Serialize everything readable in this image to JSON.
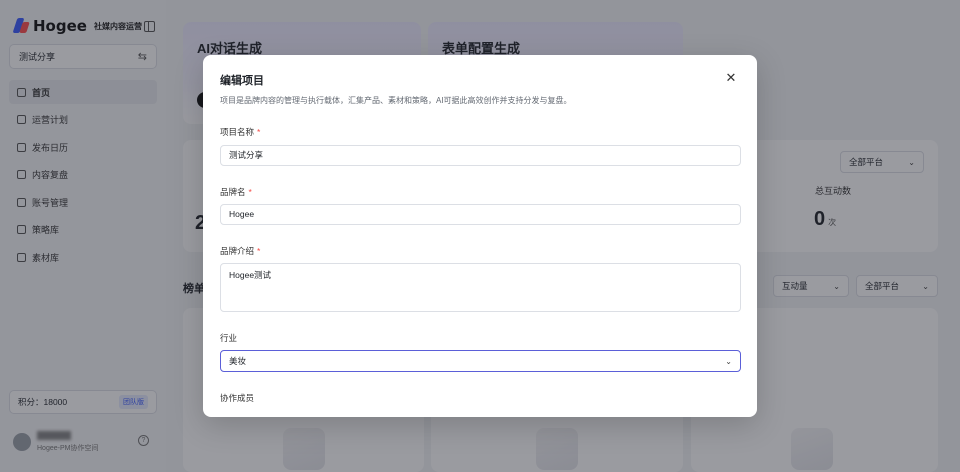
{
  "app": {
    "logo_text": "Hogee",
    "logo_sub": "社媒内容运营",
    "project_switch": "测试分享",
    "nav": [
      {
        "label": "首页",
        "active": true
      },
      {
        "label": "运营计划"
      },
      {
        "label": "发布日历"
      },
      {
        "label": "内容复盘"
      },
      {
        "label": "账号管理"
      },
      {
        "label": "策略库"
      },
      {
        "label": "素材库"
      }
    ],
    "points_label": "积分：18000",
    "team_badge": "团队版",
    "user_space": "Hogee-PM协作空间"
  },
  "main": {
    "card_ai_title": "AI对话生成",
    "card_form_title": "表单配置生成",
    "stats_platform": "全部平台",
    "stats_total_label": "总互动数",
    "stats_total_value": "0",
    "stats_total_unit": "次",
    "stats_left_value": "2",
    "ranking_title": "榜单",
    "ranking_metric": "互动量",
    "ranking_platform": "全部平台"
  },
  "modal": {
    "title": "编辑项目",
    "description": "项目是品牌内容的管理与执行载体，汇集产品、素材和策略，AI可据此高效创作并支持分发与复盘。",
    "fields": {
      "project_name_label": "项目名称",
      "project_name_value": "测试分享",
      "brand_label": "品牌名",
      "brand_value": "Hogee",
      "brand_intro_label": "品牌介绍",
      "brand_intro_value": "Hogee测试",
      "industry_label": "行业",
      "industry_value": "美妆",
      "members_label": "协作成员"
    },
    "required_mark": "*"
  },
  "colors": {
    "accent": "#5b5fd8",
    "required": "#f54a45",
    "overlay": "rgba(30,34,44,0.45)"
  }
}
